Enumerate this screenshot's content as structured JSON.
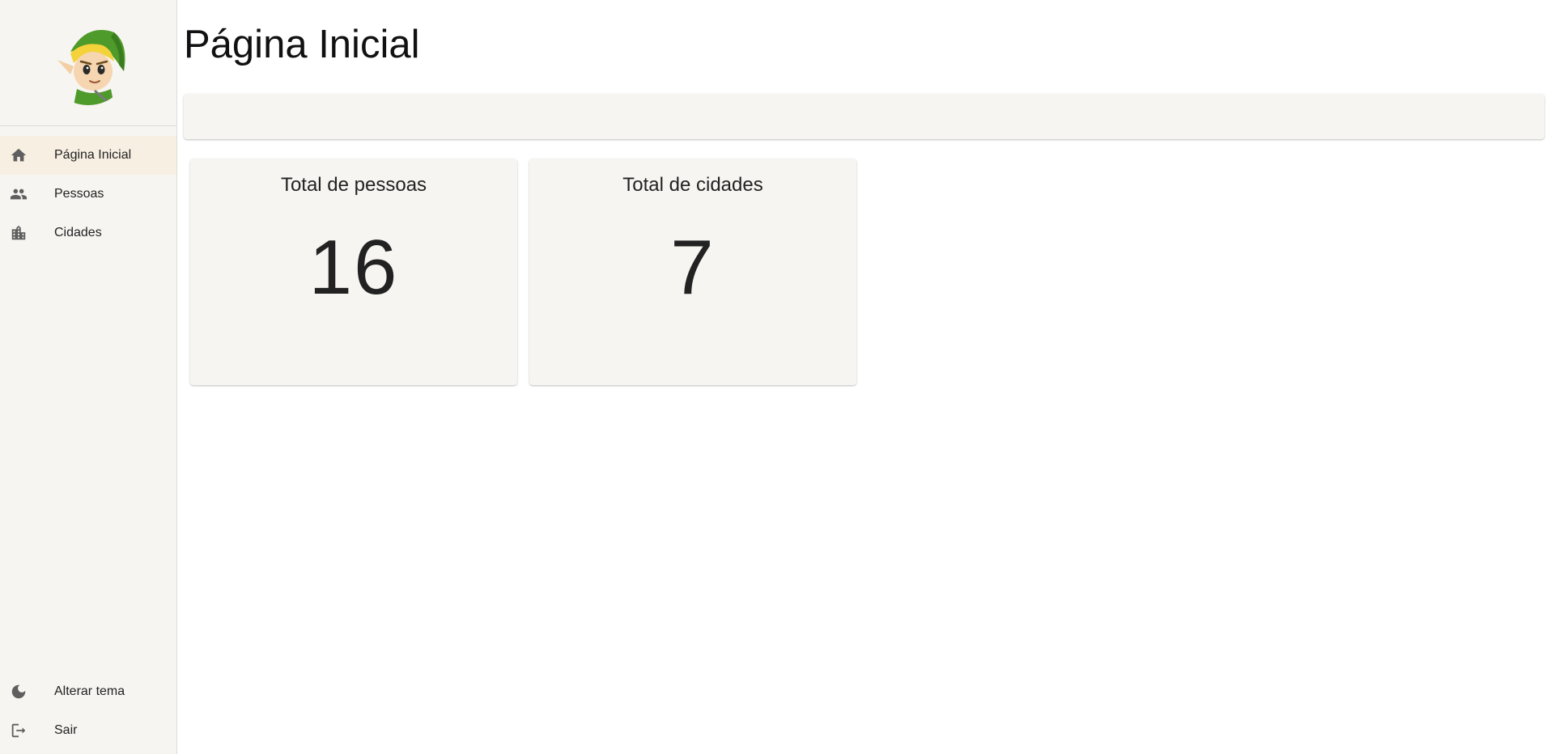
{
  "sidebar": {
    "avatar_icon": "link-character-avatar",
    "nav_items": [
      {
        "label": "Página Inicial",
        "icon": "home-icon",
        "active": true
      },
      {
        "label": "Pessoas",
        "icon": "people-icon",
        "active": false
      },
      {
        "label": "Cidades",
        "icon": "city-icon",
        "active": false
      }
    ],
    "bottom_items": [
      {
        "label": "Alterar tema",
        "icon": "moon-icon"
      },
      {
        "label": "Sair",
        "icon": "logout-icon"
      }
    ]
  },
  "main": {
    "page_title": "Página Inicial",
    "cards": [
      {
        "title": "Total de pessoas",
        "value": "16"
      },
      {
        "title": "Total de cidades",
        "value": "7"
      }
    ]
  },
  "colors": {
    "sidebar_bg": "#f6f5f2",
    "active_item_bg": "#f7efe2",
    "card_bg": "#f6f5f2",
    "icon_color": "#5f5f5f"
  }
}
